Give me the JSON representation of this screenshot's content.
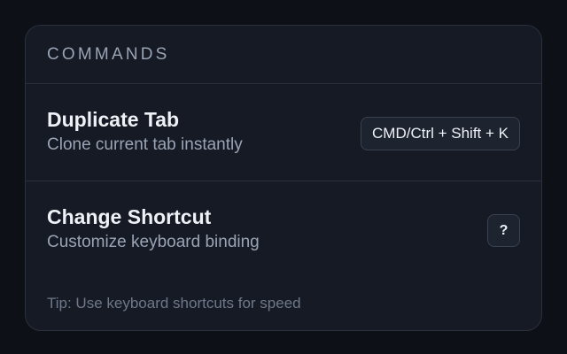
{
  "panel": {
    "title": "COMMANDS"
  },
  "commands": [
    {
      "title": "Duplicate Tab",
      "description": "Clone current tab instantly",
      "shortcut": "CMD/Ctrl + Shift + K"
    },
    {
      "title": "Change Shortcut",
      "description": "Customize keyboard binding",
      "action_label": "?"
    }
  ],
  "tip": "Tip: Use keyboard shortcuts for speed"
}
